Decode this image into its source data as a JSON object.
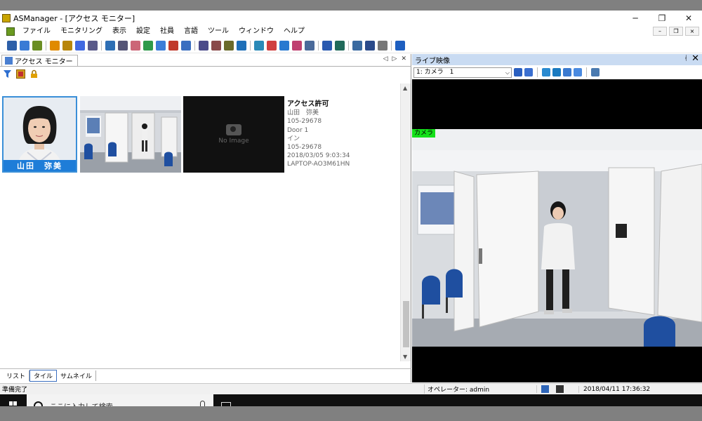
{
  "window": {
    "title": "ASManager - [アクセス モニター]",
    "controls": [
      "─",
      "❐",
      "✕"
    ]
  },
  "menu": {
    "items": [
      "ファイル",
      "モニタリング",
      "表示",
      "設定",
      "社員",
      "言語",
      "ツール",
      "ウィンドウ",
      "ヘルプ"
    ],
    "mdi_controls": [
      "–",
      "❐",
      "×"
    ]
  },
  "toolbar": {
    "icons": [
      {
        "name": "open-icon",
        "color": "#2d5fa8"
      },
      {
        "name": "import-icon",
        "color": "#3a7bd5"
      },
      {
        "name": "export-icon",
        "color": "#6b8e23"
      },
      {
        "name": "warning-icon",
        "color": "#e08a00"
      },
      {
        "name": "card-icon",
        "color": "#b8860b"
      },
      {
        "name": "user-icon",
        "color": "#4169e1"
      },
      {
        "name": "door-icon",
        "color": "#5a5a8a"
      },
      {
        "name": "controller-icon",
        "color": "#2e6fb5"
      },
      {
        "name": "camera-icon",
        "color": "#555577"
      },
      {
        "name": "hand-icon",
        "color": "#cc6677"
      },
      {
        "name": "globe-icon",
        "color": "#2e9a4a"
      },
      {
        "name": "schedule-icon",
        "color": "#3b7dd8"
      },
      {
        "name": "calendar-icon",
        "color": "#c0392b"
      },
      {
        "name": "gear-icon",
        "color": "#3b6fc0"
      },
      {
        "name": "search-icon",
        "color": "#4a4a8a"
      },
      {
        "name": "report-icon",
        "color": "#8a4a4a"
      },
      {
        "name": "copy-icon",
        "color": "#6a6a2a"
      },
      {
        "name": "clock-icon",
        "color": "#1e6fb8"
      },
      {
        "name": "book-icon",
        "color": "#2a8ab8"
      },
      {
        "name": "date-icon",
        "color": "#d04040"
      },
      {
        "name": "shield-icon",
        "color": "#2a7ad0"
      },
      {
        "name": "fingerprint-icon",
        "color": "#c04070"
      },
      {
        "name": "person-icon",
        "color": "#4a6a9a"
      },
      {
        "name": "parking-icon",
        "color": "#2a5ab0"
      },
      {
        "name": "monitor-icon",
        "color": "#206a5a"
      },
      {
        "name": "bus-icon",
        "color": "#3a6aa0"
      },
      {
        "name": "id-icon",
        "color": "#2a4a8a"
      },
      {
        "name": "lock-icon",
        "color": "#777777"
      },
      {
        "name": "help-icon",
        "color": "#1e5fc0"
      }
    ]
  },
  "access_monitor": {
    "tab_label": "アクセス モニター",
    "tab_controls": [
      "◁",
      "▷",
      "✕"
    ],
    "person": {
      "name": "山田　弥美"
    },
    "no_image_text": "No Image",
    "event": {
      "title": "アクセス許可",
      "lines": [
        "山田　弥美",
        "105-29678",
        "Door 1",
        "イン",
        "105-29678",
        "2018/03/05 9:03:34",
        "LAPTOP-AO3M61HN"
      ]
    },
    "view_tabs": [
      "リスト",
      "タイル",
      "サムネイル"
    ],
    "active_view": "タイル"
  },
  "live_video": {
    "title": "ライブ映像",
    "camera_select": "1: カメラ　1",
    "camera_label": "カメラ",
    "pin_glyph": "ᚮ",
    "close_glyph": "✕"
  },
  "status": {
    "ready": "準備完了",
    "operator": "オペレーター: admin",
    "datetime": "2018/04/11 17:36:32"
  },
  "taskbar": {
    "search_placeholder": "ここに入力して検索"
  }
}
